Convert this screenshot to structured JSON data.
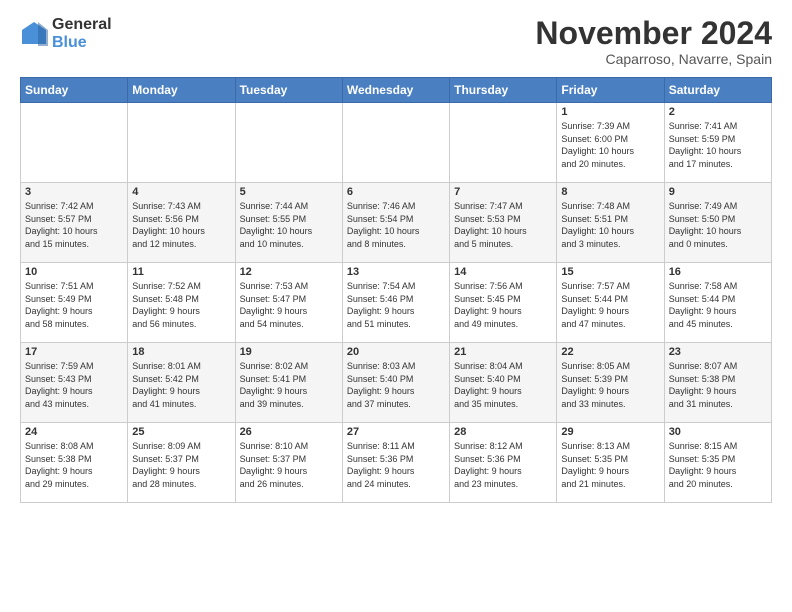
{
  "logo": {
    "line1": "General",
    "line2": "Blue"
  },
  "title": "November 2024",
  "location": "Caparroso, Navarre, Spain",
  "days_header": [
    "Sunday",
    "Monday",
    "Tuesday",
    "Wednesday",
    "Thursday",
    "Friday",
    "Saturday"
  ],
  "weeks": [
    [
      {
        "day": "",
        "info": ""
      },
      {
        "day": "",
        "info": ""
      },
      {
        "day": "",
        "info": ""
      },
      {
        "day": "",
        "info": ""
      },
      {
        "day": "",
        "info": ""
      },
      {
        "day": "1",
        "info": "Sunrise: 7:39 AM\nSunset: 6:00 PM\nDaylight: 10 hours\nand 20 minutes."
      },
      {
        "day": "2",
        "info": "Sunrise: 7:41 AM\nSunset: 5:59 PM\nDaylight: 10 hours\nand 17 minutes."
      }
    ],
    [
      {
        "day": "3",
        "info": "Sunrise: 7:42 AM\nSunset: 5:57 PM\nDaylight: 10 hours\nand 15 minutes."
      },
      {
        "day": "4",
        "info": "Sunrise: 7:43 AM\nSunset: 5:56 PM\nDaylight: 10 hours\nand 12 minutes."
      },
      {
        "day": "5",
        "info": "Sunrise: 7:44 AM\nSunset: 5:55 PM\nDaylight: 10 hours\nand 10 minutes."
      },
      {
        "day": "6",
        "info": "Sunrise: 7:46 AM\nSunset: 5:54 PM\nDaylight: 10 hours\nand 8 minutes."
      },
      {
        "day": "7",
        "info": "Sunrise: 7:47 AM\nSunset: 5:53 PM\nDaylight: 10 hours\nand 5 minutes."
      },
      {
        "day": "8",
        "info": "Sunrise: 7:48 AM\nSunset: 5:51 PM\nDaylight: 10 hours\nand 3 minutes."
      },
      {
        "day": "9",
        "info": "Sunrise: 7:49 AM\nSunset: 5:50 PM\nDaylight: 10 hours\nand 0 minutes."
      }
    ],
    [
      {
        "day": "10",
        "info": "Sunrise: 7:51 AM\nSunset: 5:49 PM\nDaylight: 9 hours\nand 58 minutes."
      },
      {
        "day": "11",
        "info": "Sunrise: 7:52 AM\nSunset: 5:48 PM\nDaylight: 9 hours\nand 56 minutes."
      },
      {
        "day": "12",
        "info": "Sunrise: 7:53 AM\nSunset: 5:47 PM\nDaylight: 9 hours\nand 54 minutes."
      },
      {
        "day": "13",
        "info": "Sunrise: 7:54 AM\nSunset: 5:46 PM\nDaylight: 9 hours\nand 51 minutes."
      },
      {
        "day": "14",
        "info": "Sunrise: 7:56 AM\nSunset: 5:45 PM\nDaylight: 9 hours\nand 49 minutes."
      },
      {
        "day": "15",
        "info": "Sunrise: 7:57 AM\nSunset: 5:44 PM\nDaylight: 9 hours\nand 47 minutes."
      },
      {
        "day": "16",
        "info": "Sunrise: 7:58 AM\nSunset: 5:44 PM\nDaylight: 9 hours\nand 45 minutes."
      }
    ],
    [
      {
        "day": "17",
        "info": "Sunrise: 7:59 AM\nSunset: 5:43 PM\nDaylight: 9 hours\nand 43 minutes."
      },
      {
        "day": "18",
        "info": "Sunrise: 8:01 AM\nSunset: 5:42 PM\nDaylight: 9 hours\nand 41 minutes."
      },
      {
        "day": "19",
        "info": "Sunrise: 8:02 AM\nSunset: 5:41 PM\nDaylight: 9 hours\nand 39 minutes."
      },
      {
        "day": "20",
        "info": "Sunrise: 8:03 AM\nSunset: 5:40 PM\nDaylight: 9 hours\nand 37 minutes."
      },
      {
        "day": "21",
        "info": "Sunrise: 8:04 AM\nSunset: 5:40 PM\nDaylight: 9 hours\nand 35 minutes."
      },
      {
        "day": "22",
        "info": "Sunrise: 8:05 AM\nSunset: 5:39 PM\nDaylight: 9 hours\nand 33 minutes."
      },
      {
        "day": "23",
        "info": "Sunrise: 8:07 AM\nSunset: 5:38 PM\nDaylight: 9 hours\nand 31 minutes."
      }
    ],
    [
      {
        "day": "24",
        "info": "Sunrise: 8:08 AM\nSunset: 5:38 PM\nDaylight: 9 hours\nand 29 minutes."
      },
      {
        "day": "25",
        "info": "Sunrise: 8:09 AM\nSunset: 5:37 PM\nDaylight: 9 hours\nand 28 minutes."
      },
      {
        "day": "26",
        "info": "Sunrise: 8:10 AM\nSunset: 5:37 PM\nDaylight: 9 hours\nand 26 minutes."
      },
      {
        "day": "27",
        "info": "Sunrise: 8:11 AM\nSunset: 5:36 PM\nDaylight: 9 hours\nand 24 minutes."
      },
      {
        "day": "28",
        "info": "Sunrise: 8:12 AM\nSunset: 5:36 PM\nDaylight: 9 hours\nand 23 minutes."
      },
      {
        "day": "29",
        "info": "Sunrise: 8:13 AM\nSunset: 5:35 PM\nDaylight: 9 hours\nand 21 minutes."
      },
      {
        "day": "30",
        "info": "Sunrise: 8:15 AM\nSunset: 5:35 PM\nDaylight: 9 hours\nand 20 minutes."
      }
    ]
  ]
}
